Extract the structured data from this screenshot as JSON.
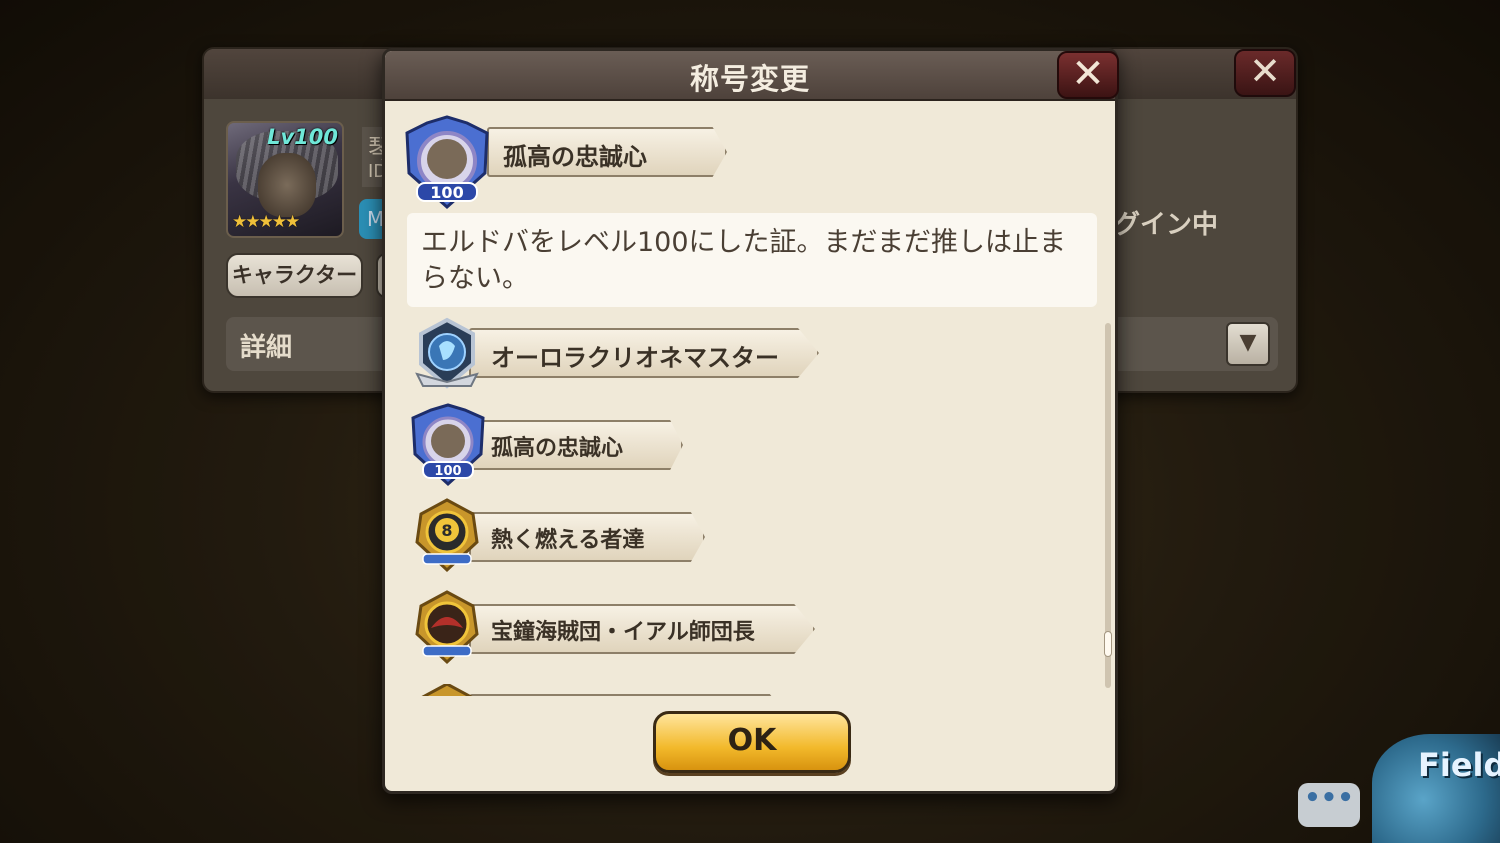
{
  "background": {
    "avatar_level": "Lv100",
    "avatar_stars": "★★★★★",
    "name_fragment": "琴",
    "id_fragment": "ID",
    "badge_fragment": "M",
    "character_button": "キャラクター",
    "detail_label": "詳細",
    "login_status": "グイン中",
    "dropdown_icon": "chevron-down-icon"
  },
  "modal": {
    "title": "称号変更",
    "close_icon": "close-icon",
    "selected_title": {
      "label": "孤高の忠誠心",
      "emblem_number": "100",
      "description": "エルドバをレベル100にした証。まだまだ推しは止まらない。"
    },
    "titles": [
      {
        "label": "オーロラクリオネマスター",
        "emblem": "clione-emblem-icon"
      },
      {
        "label": "孤高の忠誠心",
        "emblem": "eldoba-emblem-icon",
        "emblem_number": "100"
      },
      {
        "label": "熱く燃える者達",
        "emblem": "gold-8-emblem-icon",
        "emblem_number": "8"
      },
      {
        "label": "宝鐘海賊団・イアル師団長",
        "emblem": "pirate-hat-emblem-icon"
      }
    ],
    "ok_label": "OK"
  },
  "hud": {
    "chat_label": "•••",
    "field_label": "Field"
  },
  "colors": {
    "modal_bg": "#f0e9d8",
    "header_bg": "#5a4d46",
    "close_red": "#6a2828",
    "ok_gold": "#f2b92b"
  }
}
